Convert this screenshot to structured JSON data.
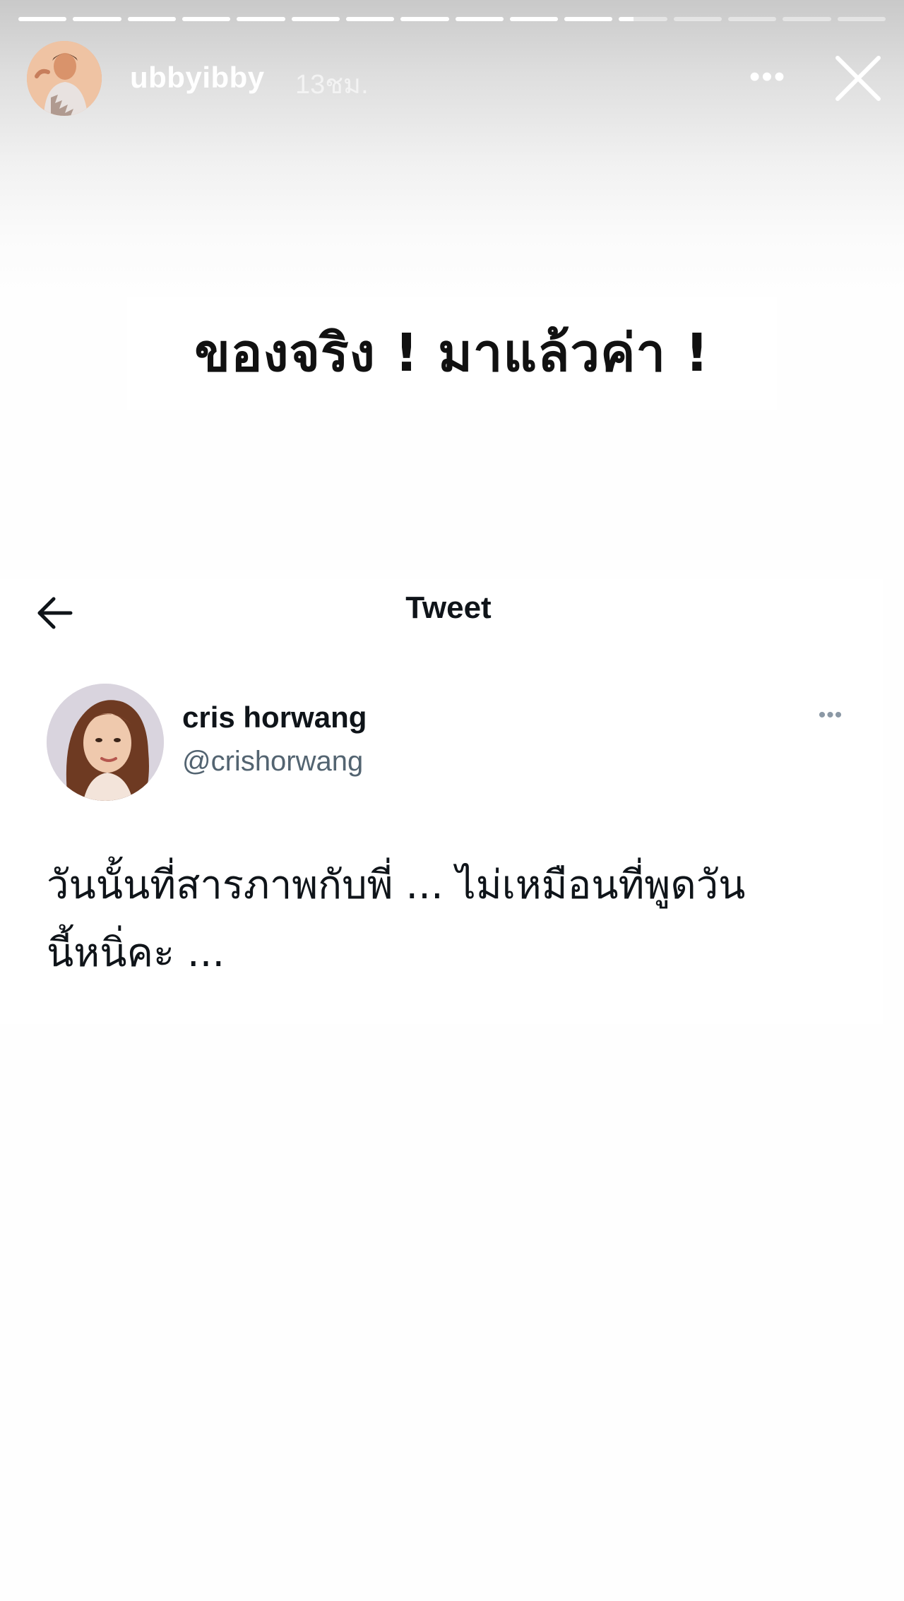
{
  "story": {
    "progress": {
      "segments_total": 16,
      "completed": 11,
      "current_fraction": 0.3
    },
    "user": {
      "avatar_icon": "profile-photo-woman",
      "username": "ubbyibby",
      "time_ago": "13ชม."
    },
    "controls": {
      "more_icon": "more-horizontal-icon",
      "more_glyph": "•••",
      "close_icon": "close-icon"
    },
    "caption": "ของจริง ! มาแล้วค่า !"
  },
  "tweet": {
    "header_title": "Tweet",
    "back_icon": "arrow-left-icon",
    "author": {
      "name": "cris horwang",
      "handle": "@crishorwang",
      "avatar_icon": "profile-photo-woman"
    },
    "more_glyph": "•••",
    "text_line1": "วันนั้นที่สารภาพกับพี่ ... ไม่เหมือนที่พูดวัน",
    "text_line2": "นี้หนิ่คะ ..."
  },
  "colors": {
    "story_text": "#ffffff",
    "tweet_text": "#0f1419",
    "tweet_secondary": "#536471",
    "caption_text": "#111111"
  }
}
